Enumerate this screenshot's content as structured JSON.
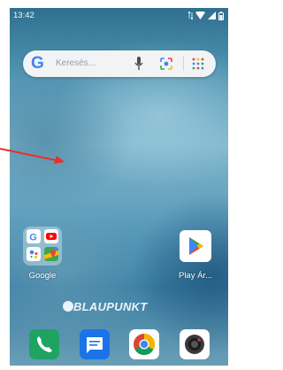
{
  "status_bar": {
    "time": "13:42"
  },
  "search_widget": {
    "logo": "G",
    "placeholder": "Keresés..."
  },
  "home": {
    "folder": {
      "label": "Google"
    },
    "play_store": {
      "label": "Play Ár..."
    },
    "brand": "BLAUPUNKT"
  },
  "dock": [
    "phone-icon",
    "messages-icon",
    "chrome-icon",
    "camera-icon"
  ],
  "colors": {
    "arrow": "#e8302b"
  }
}
